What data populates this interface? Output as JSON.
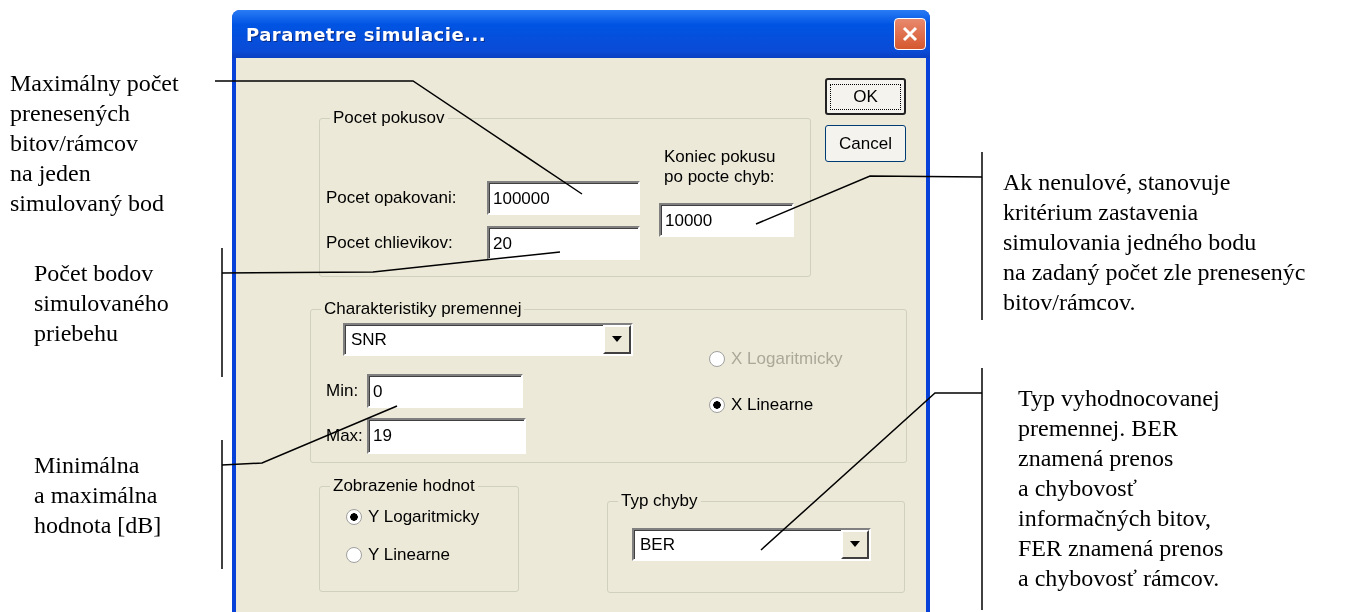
{
  "window": {
    "title": "Parametre simulacie..."
  },
  "buttons": [
    {
      "label": "OK",
      "default": true
    },
    {
      "label": "Cancel",
      "default": false
    }
  ],
  "trials": {
    "title": "Pocet pokusov",
    "fields": [
      {
        "label": "Pocet opakovani:",
        "value": "100000"
      },
      {
        "label": "Pocet chlievikov:",
        "value": "20"
      }
    ],
    "stop": {
      "label_lines": [
        "Koniec pokusu",
        "po pocte chyb:"
      ],
      "value": "10000"
    }
  },
  "variable": {
    "title": "Charakteristiky premennej",
    "select": "SNR",
    "min": {
      "label": "Min:",
      "value": "0"
    },
    "max": {
      "label": "Max:",
      "value": "19"
    },
    "scale": [
      {
        "label": "X Logaritmicky",
        "selected": false,
        "disabled": true
      },
      {
        "label": "X Linearne",
        "selected": true,
        "disabled": false
      }
    ]
  },
  "display": {
    "title": "Zobrazenie hodnot",
    "options": [
      {
        "label": "Y Logaritmicky",
        "selected": true
      },
      {
        "label": "Y Linearne",
        "selected": false
      }
    ]
  },
  "error_type": {
    "title": "Typ chyby",
    "select": "BER"
  },
  "annotations": [
    {
      "lines": [
        "Maximálny počet",
        "prenesených",
        "bitov/rámcov",
        "na jeden",
        "simulovaný bod"
      ]
    },
    {
      "lines": [
        "Počet bodov",
        "simulovaného",
        "priebehu"
      ]
    },
    {
      "lines": [
        "Minimálna",
        "a maximálna",
        "hodnota [dB]"
      ]
    },
    {
      "lines": [
        "Ak nenulové, stanovuje",
        "kritérium zastavenia",
        "simulovania jedného bodu",
        "na zadaný počet zle prenesenýc",
        "bitov/rámcov."
      ]
    },
    {
      "lines": [
        "Typ vyhodnocovanej",
        "premennej. BER",
        "znamená prenos",
        "a chybovosť",
        "informačných bitov,",
        "FER znamená prenos",
        "a chybovosť rámcov."
      ]
    }
  ]
}
